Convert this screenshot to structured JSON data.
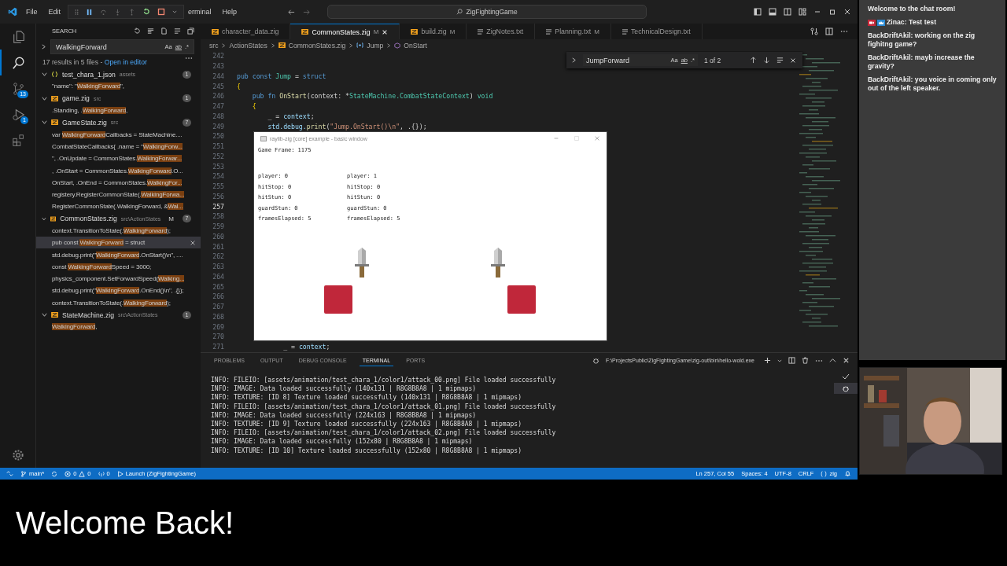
{
  "titlebar": {
    "menu": [
      {
        "label": "File"
      },
      {
        "label": "Edit"
      },
      {
        "label": "erminal"
      },
      {
        "label": "Help"
      }
    ],
    "command_center": "ZigFightingGame"
  },
  "activity_bar": [
    {
      "kind": "explorer",
      "selected": false
    },
    {
      "kind": "search",
      "selected": true
    },
    {
      "kind": "scm",
      "selected": false,
      "badge": "13"
    },
    {
      "kind": "debug",
      "selected": false,
      "badge": "1"
    },
    {
      "kind": "extensions",
      "selected": false
    }
  ],
  "sidebar": {
    "title": "SEARCH",
    "query": "WalkingForward",
    "options": [
      "Aa",
      "ab",
      ".*"
    ],
    "summary": "17 results in 5 files - ",
    "summary_link": "Open in editor",
    "files": [
      {
        "name": "test_chara_1.json",
        "path": "assets",
        "kind": "json",
        "count": "1",
        "expanded": true,
        "children": [
          {
            "before": "\"name\": \"",
            "match": "WalkingForward",
            "after": "\",",
            "selected": false
          }
        ]
      },
      {
        "name": "game.zig",
        "path": "src",
        "kind": "zig",
        "count": "1",
        "expanded": true,
        "children": [
          {
            "before": ".Standing, .",
            "match": "WalkingForward",
            "after": ",",
            "selected": false
          }
        ]
      },
      {
        "name": "GameState.zig",
        "path": "src",
        "kind": "zig",
        "count": "7",
        "expanded": true,
        "children": [
          {
            "before": "var ",
            "match": "WalkingForward",
            "after": "Callbacks = StateMachine....",
            "selected": false
          },
          {
            "before": "CombatStateCallbacks{ .name = \"",
            "match": "WalkingForw...",
            "selected": false
          },
          {
            "before": "\", .OnUpdate = CommonStates.",
            "match": "WalkingForwar...",
            "selected": false
          },
          {
            "before": ", .OnStart = CommonStates.",
            "match": "WalkingForward",
            "after": ".O...",
            "selected": false
          },
          {
            "before": "OnStart, .OnEnd = CommonStates.",
            "match": "WalkingFor...",
            "selected": false
          },
          {
            "before": "registery.RegisterCommonState(.",
            "match": "WalkingForwa...",
            "selected": false
          },
          {
            "before": "RegisterCommonState(.WalkingForward, &",
            "match": "Wal...",
            "selected": false
          }
        ]
      },
      {
        "name": "CommonStates.zig",
        "path": "src\\ActionStates",
        "kind": "zig",
        "count": "7",
        "badge": "M",
        "expanded": true,
        "children": [
          {
            "before": "context.TransitionToState(.",
            "match": "WalkingForward",
            "after": ");",
            "selected": false
          },
          {
            "before": "pub const ",
            "match": "WalkingForward",
            "after": " = struct",
            "selected": true
          },
          {
            "before": "std.debug.print(\"",
            "match": "WalkingForward",
            "after": ".OnStart()\\n\", ....",
            "selected": false
          },
          {
            "before": "const ",
            "match": "WalkingForward",
            "after": "Speed = 3000;",
            "selected": false
          },
          {
            "before": "physics_component.SetForwardSpeed(",
            "match": "Walking...",
            "selected": false
          },
          {
            "before": "std.debug.print(\"",
            "match": "WalkingForward",
            "after": ".OnEnd()\\n\", .{});",
            "selected": false
          },
          {
            "before": "context.TransitionToState(.",
            "match": "WalkingForward",
            "after": ");",
            "selected": false
          }
        ]
      },
      {
        "name": "StateMachine.zig",
        "path": "src\\ActionStates",
        "kind": "zig",
        "count": "1",
        "expanded": true,
        "children": [
          {
            "match": "WalkingForward",
            "after": ",",
            "selected": false
          }
        ]
      }
    ]
  },
  "tabs": [
    {
      "label": "character_data.zig",
      "kind": "zig",
      "selected": false
    },
    {
      "label": "CommonStates.zig",
      "kind": "zig",
      "badge": "M",
      "selected": true
    },
    {
      "label": "build.zig",
      "kind": "zig",
      "badge": "M",
      "selected": false
    },
    {
      "label": "ZigNotes.txt",
      "kind": "txt",
      "selected": false
    },
    {
      "label": "Planning.txt",
      "kind": "txt",
      "badge": "M",
      "selected": false
    },
    {
      "label": "TechnicalDesign.txt",
      "kind": "txt",
      "selected": false
    }
  ],
  "breadcrumb": [
    {
      "label": "src",
      "kind": "folder"
    },
    {
      "label": "ActionStates",
      "kind": "folder"
    },
    {
      "label": "CommonStates.zig",
      "kind": "zig"
    },
    {
      "label": "Jump",
      "kind": "variable"
    },
    {
      "label": "OnStart",
      "kind": "method"
    }
  ],
  "find_widget": {
    "query": "JumpForward",
    "options": [
      "Aa",
      "ab",
      ".*"
    ],
    "result": "1 of 2"
  },
  "code_lines": [
    {
      "number": "242"
    },
    {
      "number": "243"
    },
    {
      "number": "244",
      "tokens": [
        {
          "t": "pub const ",
          "kind": "kw"
        },
        {
          "t": "Jump",
          "kind": "type"
        },
        {
          "t": " = ",
          "kind": "plain"
        },
        {
          "t": "struct",
          "kind": "kw"
        }
      ]
    },
    {
      "number": "245",
      "tokens": [
        {
          "t": "{",
          "kind": "brace"
        }
      ]
    },
    {
      "number": "246",
      "tokens": [
        {
          "t": "    pub fn ",
          "kind": "kw"
        },
        {
          "t": "OnStart",
          "kind": "fn"
        },
        {
          "t": "(context: *",
          "kind": "plain"
        },
        {
          "t": "StateMachine.CombatStateContext",
          "kind": "type"
        },
        {
          "t": ") ",
          "kind": "plain"
        },
        {
          "t": "void",
          "kind": "type"
        }
      ]
    },
    {
      "number": "247",
      "tokens": [
        {
          "t": "    {",
          "kind": "brace"
        }
      ]
    },
    {
      "number": "248",
      "tokens": [
        {
          "t": "        _ = ",
          "kind": "plain"
        },
        {
          "t": "context",
          "kind": "var"
        },
        {
          "t": ";",
          "kind": "plain"
        }
      ]
    },
    {
      "number": "249",
      "tokens": [
        {
          "t": "        std.debug.",
          "kind": "var"
        },
        {
          "t": "print",
          "kind": "fn"
        },
        {
          "t": "(",
          "kind": "plain"
        },
        {
          "t": "\"Jump.OnStart()\\n\"",
          "kind": "str"
        },
        {
          "t": ", .{});",
          "kind": "plain"
        }
      ]
    },
    {
      "number": "250"
    },
    {
      "number": "251"
    },
    {
      "number": "252"
    },
    {
      "number": "253"
    },
    {
      "number": "254"
    },
    {
      "number": "255"
    },
    {
      "number": "256"
    },
    {
      "number": "257",
      "current": true
    },
    {
      "number": "258"
    },
    {
      "number": "259"
    },
    {
      "number": "260"
    },
    {
      "number": "261"
    },
    {
      "number": "262"
    },
    {
      "number": "263"
    },
    {
      "number": "264"
    },
    {
      "number": "265"
    },
    {
      "number": "266"
    },
    {
      "number": "267"
    },
    {
      "number": "268"
    },
    {
      "number": "269"
    },
    {
      "number": "270"
    },
    {
      "number": "271",
      "tokens": [
        {
          "t": "            _ = ",
          "kind": "plain"
        },
        {
          "t": "context",
          "kind": "var"
        },
        {
          "t": ";",
          "kind": "plain"
        }
      ]
    }
  ],
  "game_window": {
    "title": "raylib-zig [core] example - basic window",
    "frame": "Game Frame: 1175",
    "players": [
      {
        "lines": [
          "player: 0",
          "hitStop: 0",
          "hitStun: 0",
          "guardStun: 0",
          "framesElapsed: 5"
        ]
      },
      {
        "lines": [
          "player: 1",
          "hitStop: 0",
          "hitStun: 0",
          "guardStun: 0",
          "framesElapsed: 5"
        ]
      }
    ]
  },
  "panel": {
    "tabs": [
      {
        "label": "PROBLEMS",
        "selected": false
      },
      {
        "label": "OUTPUT",
        "selected": false
      },
      {
        "label": "DEBUG CONSOLE",
        "selected": false
      },
      {
        "label": "TERMINAL",
        "selected": true
      },
      {
        "label": "PORTS",
        "selected": false
      }
    ],
    "terminal_title": "F:\\ProjectsPublic\\ZigFightingGame\\zig-out\\bin\\hello-wold.exe",
    "terminal_lines": [
      "INFO: FILEIO: [assets/animation/test_chara_1/color1/attack_00.png] File loaded successfully",
      "INFO: IMAGE: Data loaded successfully (140x131 | R8G8B8A8 | 1 mipmaps)",
      "INFO: TEXTURE: [ID 8] Texture loaded successfully (140x131 | R8G8B8A8 | 1 mipmaps)",
      "INFO: FILEIO: [assets/animation/test_chara_1/color1/attack_01.png] File loaded successfully",
      "INFO: IMAGE: Data loaded successfully (224x163 | R8G8B8A8 | 1 mipmaps)",
      "INFO: TEXTURE: [ID 9] Texture loaded successfully (224x163 | R8G8B8A8 | 1 mipmaps)",
      "INFO: FILEIO: [assets/animation/test_chara_1/color1/attack_02.png] File loaded successfully",
      "INFO: IMAGE: Data loaded successfully (152x80 | R8G8B8A8 | 1 mipmaps)",
      "INFO: TEXTURE: [ID 10] Texture loaded successfully (152x80 | R8G8B8A8 | 1 mipmaps)"
    ]
  },
  "status_bar": {
    "branch": "main*",
    "errors": "0",
    "warnings": "0",
    "ports": "0",
    "launch": "Launch (ZigFightingGame)",
    "position": "Ln 257, Col 55",
    "spaces": "Spaces: 4",
    "encoding": "UTF-8",
    "eol": "CRLF",
    "language": "zig"
  },
  "chat": [
    {
      "kind": "system",
      "text": "Welcome to the chat room!"
    },
    {
      "kind": "badged",
      "author": "Zinac:",
      "text": "Test test"
    },
    {
      "kind": "message",
      "author": "BackDriftAkil:",
      "text": "working on the zig fighitng game?"
    },
    {
      "kind": "message",
      "author": "BackDriftAkil:",
      "text": "mayb increase the gravity?"
    },
    {
      "kind": "message",
      "author": "BackDriftAkil:",
      "text": "you voice in coming only out of the left speaker."
    }
  ],
  "caption": "Welcome Back!"
}
